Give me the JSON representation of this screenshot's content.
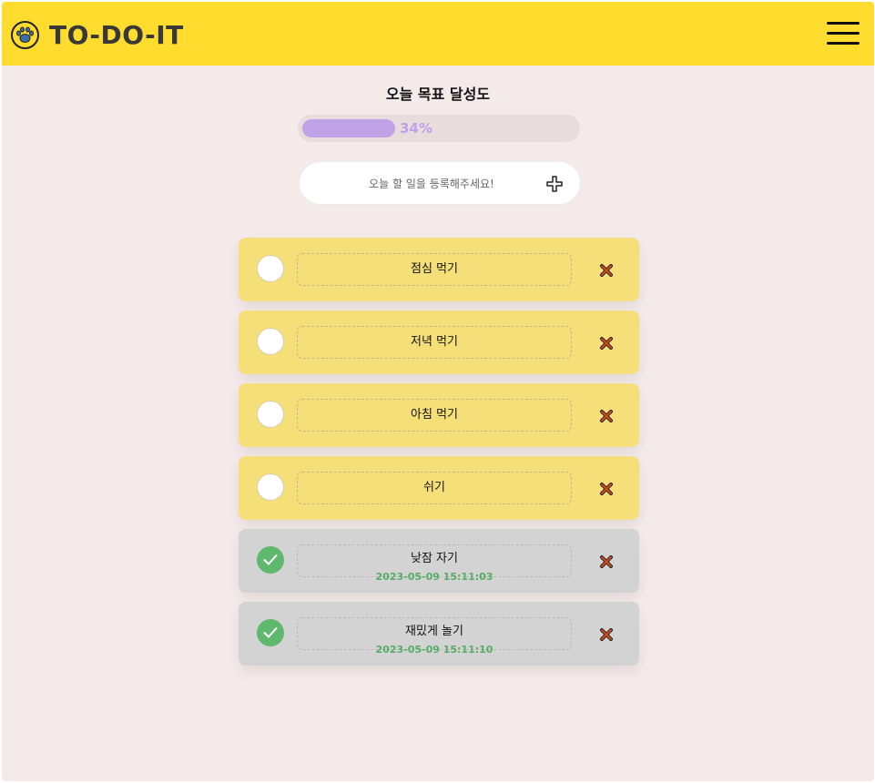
{
  "header": {
    "brand": "TO-DO-IT",
    "logo_icon": "paw-icon",
    "menu_icon": "hamburger-menu-icon",
    "background_color": "#ffdc2e"
  },
  "progress": {
    "title": "오늘 목표 달성도",
    "percent": 34,
    "percent_label": "34%",
    "fill_color": "#c0a2e6"
  },
  "add_todo": {
    "placeholder": "오늘 할 일을 등록해주세요!",
    "value": "",
    "button_icon": "plus-icon"
  },
  "todos": [
    {
      "text": "점심 먹기",
      "done": false,
      "completed_at": ""
    },
    {
      "text": "저녁 먹기",
      "done": false,
      "completed_at": ""
    },
    {
      "text": "아침 먹기",
      "done": false,
      "completed_at": ""
    },
    {
      "text": "쉬기",
      "done": false,
      "completed_at": ""
    },
    {
      "text": "낮잠 자기",
      "done": true,
      "completed_at": "2023-05-09 15:11:03"
    },
    {
      "text": "재밌게 놀기",
      "done": true,
      "completed_at": "2023-05-09 15:11:10"
    }
  ],
  "colors": {
    "todo_bg": "#f4df78",
    "done_bg": "#d3d3d3",
    "done_check": "#5fb86e",
    "delete_icon": "#d24a1c"
  }
}
